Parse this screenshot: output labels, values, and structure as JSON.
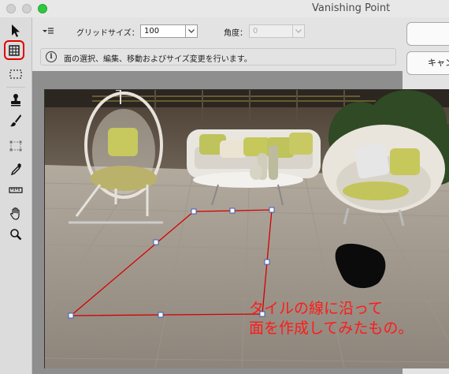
{
  "window": {
    "title": "Vanishing Point"
  },
  "tools": [
    {
      "name": "edit-plane-tool",
      "icon": "arrow-pointer-icon",
      "selected": false
    },
    {
      "name": "create-plane-tool",
      "icon": "grid-plane-icon",
      "selected": true
    },
    {
      "name": "marquee-tool",
      "icon": "dashed-rect-icon"
    },
    {
      "name": "stamp-tool",
      "icon": "stamp-icon"
    },
    {
      "name": "brush-tool",
      "icon": "brush-icon"
    },
    {
      "name": "transform-tool",
      "icon": "transform-icon"
    },
    {
      "name": "eyedropper-tool",
      "icon": "eyedropper-icon"
    },
    {
      "name": "measure-tool",
      "icon": "ruler-icon"
    },
    {
      "name": "hand-tool",
      "icon": "hand-icon"
    },
    {
      "name": "zoom-tool",
      "icon": "magnifier-icon"
    }
  ],
  "options": {
    "grid_size_label": "グリッドサイズ：",
    "grid_size_value": "100",
    "angle_label": "角度：",
    "angle_value": "0",
    "hint": "面の選択、編集、移動およびサイズ変更を行います。"
  },
  "side_buttons": {
    "ok_label": "",
    "cancel_label": "キャンセル"
  },
  "annotation": {
    "line1": "タイルの線に沿って",
    "line2": "面を作成してみたもの。",
    "color": "#ff1a1a"
  },
  "colors": {
    "plane_outline": "#d40000",
    "highlight": "#e30000"
  }
}
